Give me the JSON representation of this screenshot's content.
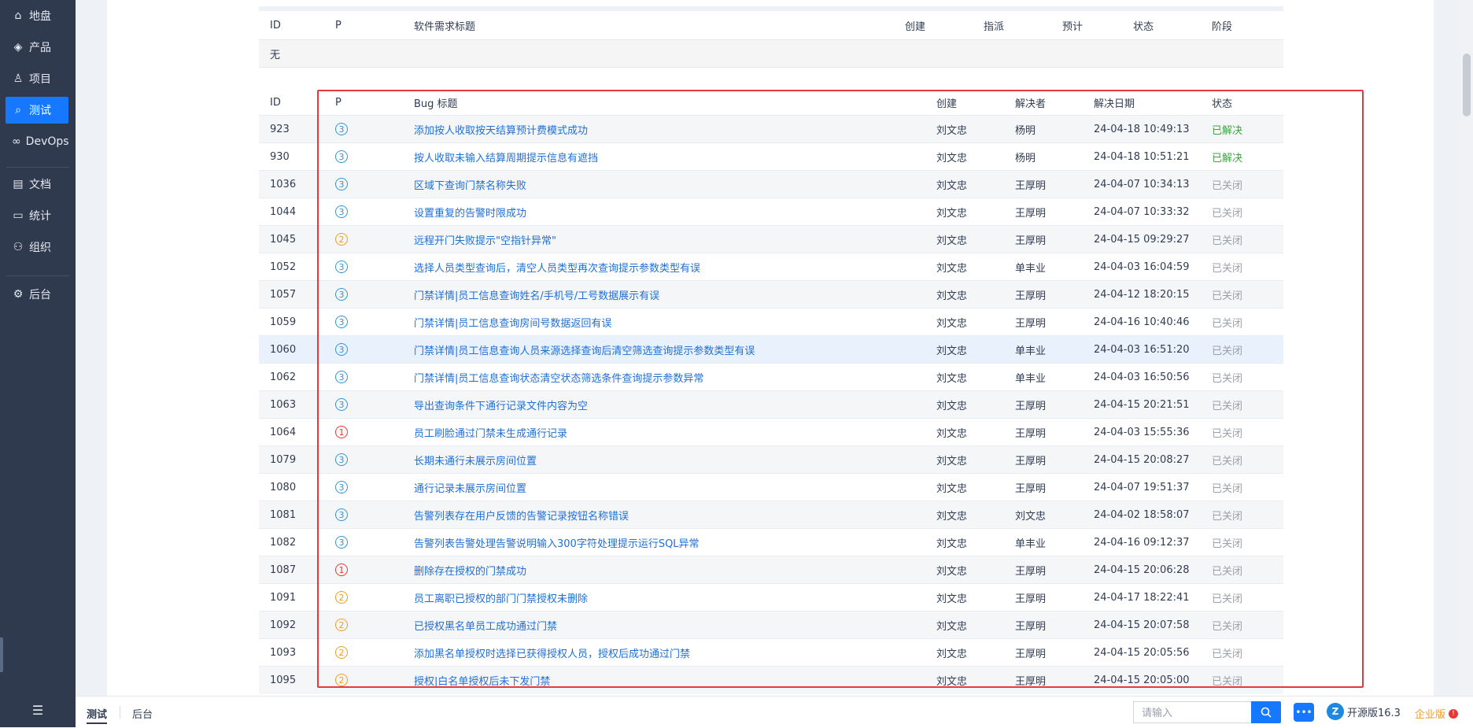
{
  "sidebar": {
    "items": [
      {
        "label": "地盘",
        "icon": "home-icon"
      },
      {
        "label": "产品",
        "icon": "product-icon"
      },
      {
        "label": "项目",
        "icon": "project-icon"
      },
      {
        "label": "测试",
        "icon": "test-search-icon",
        "active": true
      },
      {
        "label": "DevOps",
        "icon": "devops-icon"
      },
      {
        "label": "文档",
        "icon": "doc-icon"
      },
      {
        "label": "统计",
        "icon": "chart-icon"
      },
      {
        "label": "组织",
        "icon": "org-icon"
      },
      {
        "label": "后台",
        "icon": "gear-icon"
      }
    ]
  },
  "requirements": {
    "headers": [
      "ID",
      "P",
      "软件需求标题",
      "创建",
      "指派",
      "预计",
      "状态",
      "阶段"
    ],
    "empty_text": "无"
  },
  "bugs": {
    "headers": [
      "ID",
      "P",
      "Bug 标题",
      "创建",
      "解决者",
      "解决日期",
      "状态"
    ],
    "rows": [
      {
        "id": "923",
        "p": "3",
        "title": "添加按人收取按天结算预计费模式成功",
        "creator": "刘文忠",
        "resolver": "杨明",
        "date": "24-04-18 10:49:13",
        "status": "已解决"
      },
      {
        "id": "930",
        "p": "3",
        "title": "按人收取未输入结算周期提示信息有遮挡",
        "creator": "刘文忠",
        "resolver": "杨明",
        "date": "24-04-18 10:51:21",
        "status": "已解决"
      },
      {
        "id": "1036",
        "p": "3",
        "title": "区域下查询门禁名称失败",
        "creator": "刘文忠",
        "resolver": "王厚明",
        "date": "24-04-07 10:34:13",
        "status": "已关闭"
      },
      {
        "id": "1044",
        "p": "3",
        "title": "设置重复的告警时限成功",
        "creator": "刘文忠",
        "resolver": "王厚明",
        "date": "24-04-07 10:33:32",
        "status": "已关闭"
      },
      {
        "id": "1045",
        "p": "2",
        "title": "远程开门失败提示\"空指针异常\"",
        "creator": "刘文忠",
        "resolver": "王厚明",
        "date": "24-04-15 09:29:27",
        "status": "已关闭"
      },
      {
        "id": "1052",
        "p": "3",
        "title": "选择人员类型查询后，清空人员类型再次查询提示参数类型有误",
        "creator": "刘文忠",
        "resolver": "单丰业",
        "date": "24-04-03 16:04:59",
        "status": "已关闭"
      },
      {
        "id": "1057",
        "p": "3",
        "title": "门禁详情|员工信息查询姓名/手机号/工号数据展示有误",
        "creator": "刘文忠",
        "resolver": "王厚明",
        "date": "24-04-12 18:20:15",
        "status": "已关闭"
      },
      {
        "id": "1059",
        "p": "3",
        "title": "门禁详情|员工信息查询房间号数据返回有误",
        "creator": "刘文忠",
        "resolver": "王厚明",
        "date": "24-04-16 10:40:46",
        "status": "已关闭"
      },
      {
        "id": "1060",
        "p": "3",
        "title": "门禁详情|员工信息查询人员来源选择查询后清空筛选查询提示参数类型有误",
        "creator": "刘文忠",
        "resolver": "单丰业",
        "date": "24-04-03 16:51:20",
        "status": "已关闭"
      },
      {
        "id": "1062",
        "p": "3",
        "title": "门禁详情|员工信息查询状态清空状态筛选条件查询提示参数异常",
        "creator": "刘文忠",
        "resolver": "单丰业",
        "date": "24-04-03 16:50:56",
        "status": "已关闭"
      },
      {
        "id": "1063",
        "p": "3",
        "title": "导出查询条件下通行记录文件内容为空",
        "creator": "刘文忠",
        "resolver": "王厚明",
        "date": "24-04-15 20:21:51",
        "status": "已关闭"
      },
      {
        "id": "1064",
        "p": "1",
        "title": "员工刷脸通过门禁未生成通行记录",
        "creator": "刘文忠",
        "resolver": "王厚明",
        "date": "24-04-03 15:55:36",
        "status": "已关闭"
      },
      {
        "id": "1079",
        "p": "3",
        "title": "长期未通行未展示房间位置",
        "creator": "刘文忠",
        "resolver": "王厚明",
        "date": "24-04-15 20:08:27",
        "status": "已关闭"
      },
      {
        "id": "1080",
        "p": "3",
        "title": "通行记录未展示房间位置",
        "creator": "刘文忠",
        "resolver": "王厚明",
        "date": "24-04-07 19:51:37",
        "status": "已关闭"
      },
      {
        "id": "1081",
        "p": "3",
        "title": "告警列表存在用户反馈的告警记录按钮名称错误",
        "creator": "刘文忠",
        "resolver": "刘文忠",
        "date": "24-04-02 18:58:07",
        "status": "已关闭"
      },
      {
        "id": "1082",
        "p": "3",
        "title": "告警列表告警处理告警说明输入300字符处理提示运行SQL异常",
        "creator": "刘文忠",
        "resolver": "单丰业",
        "date": "24-04-16 09:12:37",
        "status": "已关闭"
      },
      {
        "id": "1087",
        "p": "1",
        "title": "删除存在授权的门禁成功",
        "creator": "刘文忠",
        "resolver": "王厚明",
        "date": "24-04-15 20:06:28",
        "status": "已关闭"
      },
      {
        "id": "1091",
        "p": "2",
        "title": "员工离职已授权的部门门禁授权未删除",
        "creator": "刘文忠",
        "resolver": "王厚明",
        "date": "24-04-17 18:22:41",
        "status": "已关闭"
      },
      {
        "id": "1092",
        "p": "2",
        "title": "已授权黑名单员工成功通过门禁",
        "creator": "刘文忠",
        "resolver": "王厚明",
        "date": "24-04-15 20:07:58",
        "status": "已关闭"
      },
      {
        "id": "1093",
        "p": "2",
        "title": "添加黑名单授权时选择已获得授权人员，授权后成功通过门禁",
        "creator": "刘文忠",
        "resolver": "王厚明",
        "date": "24-04-15 20:05:56",
        "status": "已关闭"
      },
      {
        "id": "1095",
        "p": "2",
        "title": "授权|白名单授权后未下发门禁",
        "creator": "刘文忠",
        "resolver": "王厚明",
        "date": "24-04-15 20:05:00",
        "status": "已关闭"
      }
    ]
  },
  "footer": {
    "tabs": [
      "测试",
      "后台"
    ],
    "search_placeholder": "请输入",
    "version": "开源版16.3",
    "enterprise": "企业版",
    "enterprise_badge": "!"
  }
}
